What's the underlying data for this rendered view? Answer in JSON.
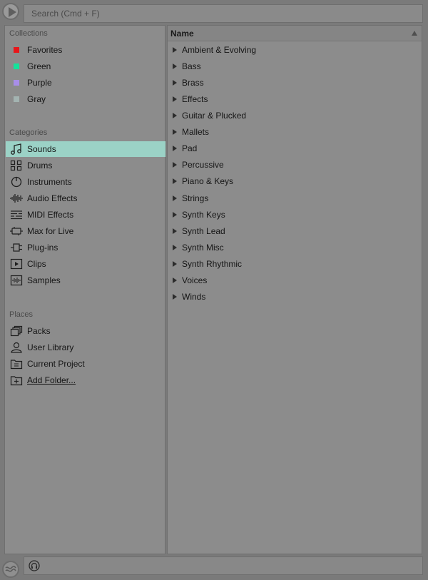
{
  "search": {
    "placeholder": "Search (Cmd + F)"
  },
  "collections": {
    "title": "Collections",
    "items": [
      {
        "label": "Favorites",
        "color": "#e8161a"
      },
      {
        "label": "Green",
        "color": "#14e39a"
      },
      {
        "label": "Purple",
        "color": "#a88ee8"
      },
      {
        "label": "Gray",
        "color": "#a3b3b1"
      }
    ]
  },
  "categories": {
    "title": "Categories",
    "items": [
      {
        "label": "Sounds",
        "icon": "music-note-icon"
      },
      {
        "label": "Drums",
        "icon": "grid-icon"
      },
      {
        "label": "Instruments",
        "icon": "knob-icon"
      },
      {
        "label": "Audio Effects",
        "icon": "waveform-icon"
      },
      {
        "label": "MIDI Effects",
        "icon": "midi-lines-icon"
      },
      {
        "label": "Max for Live",
        "icon": "max-icon"
      },
      {
        "label": "Plug-ins",
        "icon": "plug-icon"
      },
      {
        "label": "Clips",
        "icon": "clip-play-icon"
      },
      {
        "label": "Samples",
        "icon": "sample-wave-icon"
      }
    ]
  },
  "places": {
    "title": "Places",
    "items": [
      {
        "label": "Packs",
        "icon": "packs-icon"
      },
      {
        "label": "User Library",
        "icon": "user-icon"
      },
      {
        "label": "Current Project",
        "icon": "project-folder-icon"
      },
      {
        "label": "Add Folder...",
        "icon": "add-folder-icon"
      }
    ]
  },
  "browser": {
    "column_header": "Name",
    "rows": [
      "Ambient & Evolving",
      "Bass",
      "Brass",
      "Effects",
      "Guitar & Plucked",
      "Mallets",
      "Pad",
      "Percussive",
      "Piano & Keys",
      "Strings",
      "Synth Keys",
      "Synth Lead",
      "Synth Misc",
      "Synth Rhythmic",
      "Voices",
      "Winds"
    ]
  },
  "colors": {
    "selection": "#9bd2c6",
    "panel": "#8c8c8c"
  }
}
